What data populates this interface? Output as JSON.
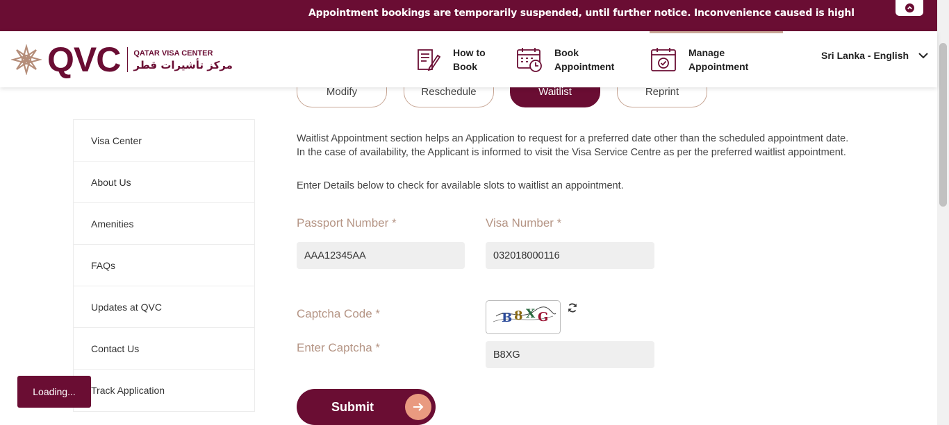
{
  "banner": {
    "text": "Appointment bookings are temporarily suspended, until further notice. Inconvenience caused is highly regretted."
  },
  "header": {
    "logo_text": "QVC",
    "logo_en": "QATAR VISA CENTER",
    "logo_ar": "مركز تأشيرات قطر",
    "nav": [
      {
        "label": "How to\nBook",
        "icon": "document-pen-icon"
      },
      {
        "label": "Book\nAppointment",
        "icon": "calendar-clock-icon"
      },
      {
        "label": "Manage\nAppointment",
        "icon": "calendar-check-icon"
      }
    ],
    "language": "Sri Lanka - English"
  },
  "sidebar": {
    "items": [
      {
        "label": "Visa Center"
      },
      {
        "label": "About Us"
      },
      {
        "label": "Amenities"
      },
      {
        "label": "FAQs"
      },
      {
        "label": "Updates at QVC"
      },
      {
        "label": "Contact Us"
      },
      {
        "label": "Track Application"
      }
    ]
  },
  "tabs": [
    {
      "label": "Modify",
      "active": false
    },
    {
      "label": "Reschedule",
      "active": false
    },
    {
      "label": "Waitlist",
      "active": true
    },
    {
      "label": "Reprint",
      "active": false
    }
  ],
  "content": {
    "description": "Waitlist Appointment section helps an Application to request for a preferred date other than the scheduled appointment date. In the case of availability, the Applicant is informed to visit the Visa Service Centre as per the preferred waitlist appointment.",
    "instruction": "Enter Details below to check for available slots to waitlist an appointment."
  },
  "form": {
    "passport_label": "Passport Number *",
    "passport_value": "AAA12345AA",
    "visa_label": "Visa Number *",
    "visa_value": "032018000116",
    "captcha_label": "Captcha Code *",
    "captcha_image_text": "B8XG",
    "enter_captcha_label": "Enter Captcha *",
    "enter_captcha_value": "B8XG",
    "submit_label": "Submit"
  },
  "loading_text": "Loading...",
  "colors": {
    "brand": "#6a0d33",
    "accent": "#c8a796",
    "label": "#b59585",
    "submit_arrow": "#e99a80"
  }
}
